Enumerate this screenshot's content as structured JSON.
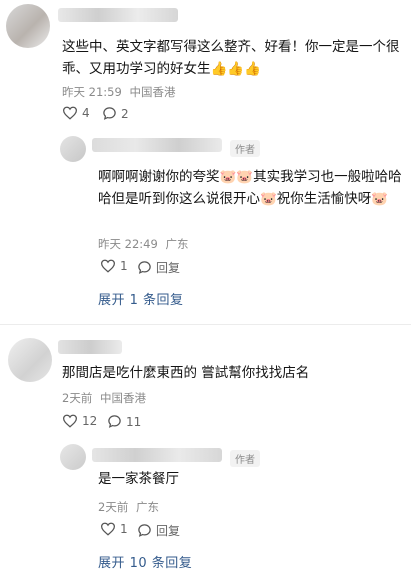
{
  "comments": [
    {
      "text": "这些中、英文字都写得这么整齐、好看！你一定是一个很乖、又用功学习的好女生👍👍👍",
      "time": "昨天 21:59",
      "location": "中国香港",
      "likes": "4",
      "replies_count": "2",
      "reply": {
        "author_tag": "作者",
        "text": "啊啊啊谢谢你的夸奖🐷🐷其实我学习也一般啦哈哈哈但是听到你这么说很开心🐷祝你生活愉快呀🐷",
        "time": "昨天 22:49",
        "location": "广东",
        "likes": "1",
        "reply_label": "回复"
      },
      "expand_label": "展开 1 条回复"
    },
    {
      "text": "那間店是吃什麼東西的 嘗試幫你找找店名",
      "time": "2天前",
      "location": "中国香港",
      "likes": "12",
      "replies_count": "11",
      "reply": {
        "author_tag": "作者",
        "text": "是一家茶餐厅",
        "time": "2天前",
        "location": "广东",
        "likes": "1",
        "reply_label": "回复"
      },
      "expand_label": "展开 10 条回复"
    }
  ],
  "colors": {
    "link": "#345b8c",
    "meta": "#8a8a8a"
  },
  "icons": [
    "heart-icon",
    "comment-icon",
    "author-avatar",
    "user-avatar"
  ]
}
